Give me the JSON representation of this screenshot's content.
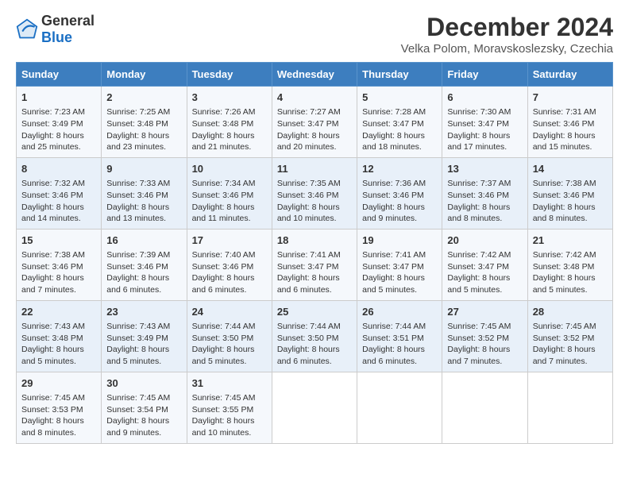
{
  "logo": {
    "text_general": "General",
    "text_blue": "Blue"
  },
  "title": "December 2024",
  "subtitle": "Velka Polom, Moravskoslezsky, Czechia",
  "headers": [
    "Sunday",
    "Monday",
    "Tuesday",
    "Wednesday",
    "Thursday",
    "Friday",
    "Saturday"
  ],
  "weeks": [
    [
      {
        "day": "1",
        "sunrise": "7:23 AM",
        "sunset": "3:49 PM",
        "daylight": "8 hours and 25 minutes."
      },
      {
        "day": "2",
        "sunrise": "7:25 AM",
        "sunset": "3:48 PM",
        "daylight": "8 hours and 23 minutes."
      },
      {
        "day": "3",
        "sunrise": "7:26 AM",
        "sunset": "3:48 PM",
        "daylight": "8 hours and 21 minutes."
      },
      {
        "day": "4",
        "sunrise": "7:27 AM",
        "sunset": "3:47 PM",
        "daylight": "8 hours and 20 minutes."
      },
      {
        "day": "5",
        "sunrise": "7:28 AM",
        "sunset": "3:47 PM",
        "daylight": "8 hours and 18 minutes."
      },
      {
        "day": "6",
        "sunrise": "7:30 AM",
        "sunset": "3:47 PM",
        "daylight": "8 hours and 17 minutes."
      },
      {
        "day": "7",
        "sunrise": "7:31 AM",
        "sunset": "3:46 PM",
        "daylight": "8 hours and 15 minutes."
      }
    ],
    [
      {
        "day": "8",
        "sunrise": "7:32 AM",
        "sunset": "3:46 PM",
        "daylight": "8 hours and 14 minutes."
      },
      {
        "day": "9",
        "sunrise": "7:33 AM",
        "sunset": "3:46 PM",
        "daylight": "8 hours and 13 minutes."
      },
      {
        "day": "10",
        "sunrise": "7:34 AM",
        "sunset": "3:46 PM",
        "daylight": "8 hours and 11 minutes."
      },
      {
        "day": "11",
        "sunrise": "7:35 AM",
        "sunset": "3:46 PM",
        "daylight": "8 hours and 10 minutes."
      },
      {
        "day": "12",
        "sunrise": "7:36 AM",
        "sunset": "3:46 PM",
        "daylight": "8 hours and 9 minutes."
      },
      {
        "day": "13",
        "sunrise": "7:37 AM",
        "sunset": "3:46 PM",
        "daylight": "8 hours and 8 minutes."
      },
      {
        "day": "14",
        "sunrise": "7:38 AM",
        "sunset": "3:46 PM",
        "daylight": "8 hours and 8 minutes."
      }
    ],
    [
      {
        "day": "15",
        "sunrise": "7:38 AM",
        "sunset": "3:46 PM",
        "daylight": "8 hours and 7 minutes."
      },
      {
        "day": "16",
        "sunrise": "7:39 AM",
        "sunset": "3:46 PM",
        "daylight": "8 hours and 6 minutes."
      },
      {
        "day": "17",
        "sunrise": "7:40 AM",
        "sunset": "3:46 PM",
        "daylight": "8 hours and 6 minutes."
      },
      {
        "day": "18",
        "sunrise": "7:41 AM",
        "sunset": "3:47 PM",
        "daylight": "8 hours and 6 minutes."
      },
      {
        "day": "19",
        "sunrise": "7:41 AM",
        "sunset": "3:47 PM",
        "daylight": "8 hours and 5 minutes."
      },
      {
        "day": "20",
        "sunrise": "7:42 AM",
        "sunset": "3:47 PM",
        "daylight": "8 hours and 5 minutes."
      },
      {
        "day": "21",
        "sunrise": "7:42 AM",
        "sunset": "3:48 PM",
        "daylight": "8 hours and 5 minutes."
      }
    ],
    [
      {
        "day": "22",
        "sunrise": "7:43 AM",
        "sunset": "3:48 PM",
        "daylight": "8 hours and 5 minutes."
      },
      {
        "day": "23",
        "sunrise": "7:43 AM",
        "sunset": "3:49 PM",
        "daylight": "8 hours and 5 minutes."
      },
      {
        "day": "24",
        "sunrise": "7:44 AM",
        "sunset": "3:50 PM",
        "daylight": "8 hours and 5 minutes."
      },
      {
        "day": "25",
        "sunrise": "7:44 AM",
        "sunset": "3:50 PM",
        "daylight": "8 hours and 6 minutes."
      },
      {
        "day": "26",
        "sunrise": "7:44 AM",
        "sunset": "3:51 PM",
        "daylight": "8 hours and 6 minutes."
      },
      {
        "day": "27",
        "sunrise": "7:45 AM",
        "sunset": "3:52 PM",
        "daylight": "8 hours and 7 minutes."
      },
      {
        "day": "28",
        "sunrise": "7:45 AM",
        "sunset": "3:52 PM",
        "daylight": "8 hours and 7 minutes."
      }
    ],
    [
      {
        "day": "29",
        "sunrise": "7:45 AM",
        "sunset": "3:53 PM",
        "daylight": "8 hours and 8 minutes."
      },
      {
        "day": "30",
        "sunrise": "7:45 AM",
        "sunset": "3:54 PM",
        "daylight": "8 hours and 9 minutes."
      },
      {
        "day": "31",
        "sunrise": "7:45 AM",
        "sunset": "3:55 PM",
        "daylight": "8 hours and 10 minutes."
      },
      null,
      null,
      null,
      null
    ]
  ]
}
